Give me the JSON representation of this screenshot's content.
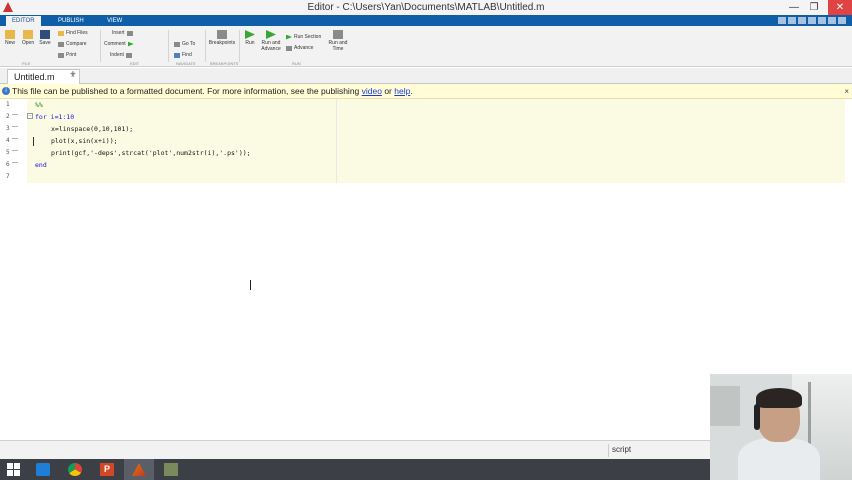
{
  "window": {
    "title": "Editor - C:\\Users\\Yan\\Documents\\MATLAB\\Untitled.m",
    "min_glyph": "—",
    "max_glyph": "❐",
    "close_glyph": "✕"
  },
  "ribbon": {
    "tabs": [
      "EDITOR",
      "PUBLISH",
      "VIEW"
    ],
    "buttons": {
      "new": "New",
      "open": "Open",
      "save": "Save",
      "find_files": "Find Files",
      "compare": "Compare",
      "print": "Print",
      "insert": "Insert",
      "comment": "Comment",
      "indent": "Indent",
      "go_to": "Go To",
      "find": "Find",
      "breakpoints": "Breakpoints",
      "run": "Run",
      "run_and_advance": "Run and Advance",
      "run_section": "Run Section",
      "advance": "Advance",
      "run_and_time": "Run and Time"
    },
    "group_labels": [
      "FILE",
      "NAVIGATE",
      "EDIT",
      "BREAKPOINTS",
      "RUN"
    ]
  },
  "editor_tabs": {
    "active_file": "Untitled.m",
    "close_glyph": "×",
    "new_tab_glyph": "+"
  },
  "info_bar": {
    "text_before": "This file can be published to a formatted document. For more information, see the publishing ",
    "link_video": "video",
    "text_mid": " or ",
    "link_help": "help",
    "text_after": ".",
    "close_glyph": "×"
  },
  "code": {
    "line_numbers": [
      "1",
      "2",
      "3",
      "4",
      "5",
      "6",
      "7"
    ],
    "lines": [
      {
        "n": "1",
        "dash": "",
        "text": "%%"
      },
      {
        "n": "2",
        "dash": "—",
        "text": "for i=1:10"
      },
      {
        "n": "3",
        "dash": "—",
        "text": "x=linspace(0,10,101);"
      },
      {
        "n": "4",
        "dash": "—",
        "text": "plot(x,sin(x+i));"
      },
      {
        "n": "5",
        "dash": "—",
        "text": "print(gcf,'-deps',strcat('plot',num2str(i),'.ps'));"
      },
      {
        "n": "6",
        "dash": "—",
        "text": "end"
      },
      {
        "n": "7",
        "dash": "",
        "text": ""
      }
    ]
  },
  "status_bar": {
    "file_type": "script"
  },
  "taskbar": {
    "apps": [
      "start-button",
      "dropbox",
      "chrome",
      "powerpoint",
      "matlab",
      "other-app"
    ]
  }
}
